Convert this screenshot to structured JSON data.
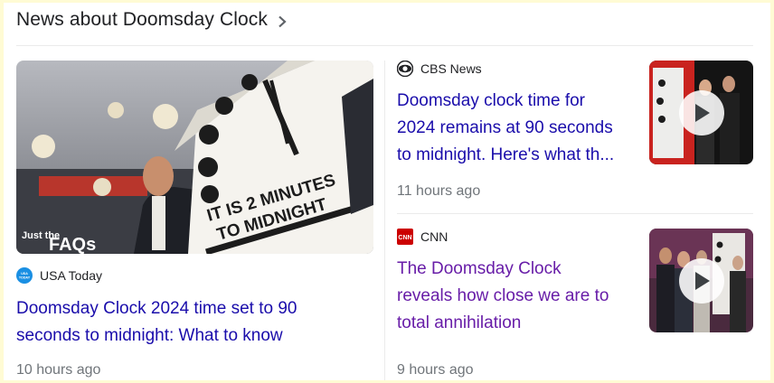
{
  "header": {
    "title": "News about Doomsday Clock",
    "chevron_icon": "chevron-right-icon"
  },
  "main_story": {
    "image_overlay": {
      "badge_line1": "Just the",
      "badge_line2": "FAQs",
      "clock_text_line1": "IT IS 2 MINUTES",
      "clock_text_line2": "TO MIDNIGHT"
    },
    "source": "USA Today",
    "source_logo_text": "USA TODAY",
    "title_line1": "Doomsday Clock 2024 time set to 90",
    "title_line2": "seconds to midnight: What to know",
    "time": "10 hours ago"
  },
  "side_stories": [
    {
      "source": "CBS News",
      "title_line1": "Doomsday clock time for",
      "title_line2": "2024 remains at 90 seconds",
      "title_line3": "to midnight. Here's what th...",
      "time": "11 hours ago",
      "has_video": true
    },
    {
      "source": "CNN",
      "source_logo_text": "CNN",
      "title_line1": "The Doomsday Clock",
      "title_line2": "reveals how close we are to",
      "title_line3": "total annihilation",
      "time": "9 hours ago",
      "has_video": true
    }
  ],
  "colors": {
    "link": "#1a0dab",
    "visited_link": "#681da8",
    "meta": "#70757a",
    "page_bg": "#fffbd4"
  }
}
